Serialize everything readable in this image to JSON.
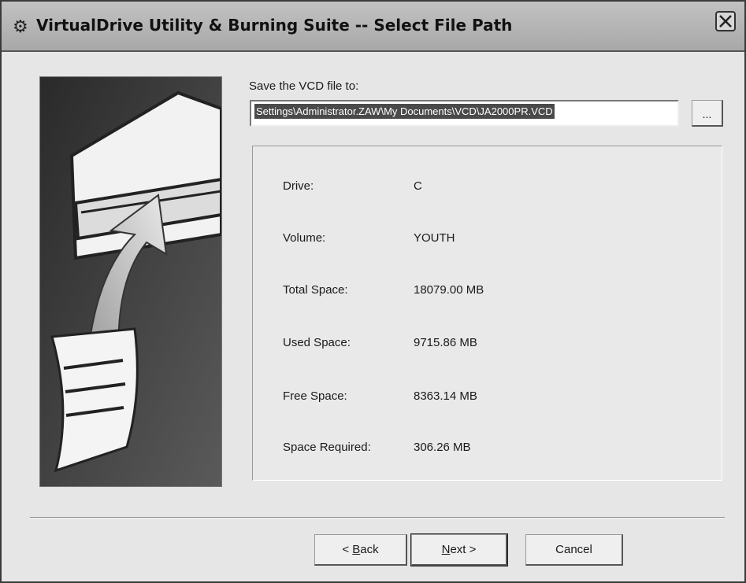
{
  "window": {
    "title": "VirtualDrive Utility & Burning Suite -- Select File Path",
    "title_icon": "gear-wizard-icon",
    "close_icon": "close-icon"
  },
  "illustration": {
    "icon": "cd-drive-arrow-document-illustration"
  },
  "save": {
    "label": "Save the VCD file to:",
    "path_value": "Settings\\Administrator.ZAW\\My Documents\\VCD\\JA2000PR.VCD",
    "browse_label": "..."
  },
  "drive_info": [
    {
      "label": "Drive:",
      "value": "C"
    },
    {
      "label": "Volume:",
      "value": "YOUTH"
    },
    {
      "label": "Total Space:",
      "value": "18079.00 MB"
    },
    {
      "label": "Used Space:",
      "value": "9715.86 MB"
    },
    {
      "label": "Free Space:",
      "value": "8363.14 MB"
    },
    {
      "label": "Space Required:",
      "value": "306.26 MB"
    }
  ],
  "buttons": {
    "back_prefix": "< ",
    "back_accel": "B",
    "back_rest": "ack",
    "next_accel": "N",
    "next_rest": "ext >",
    "cancel": "Cancel"
  }
}
